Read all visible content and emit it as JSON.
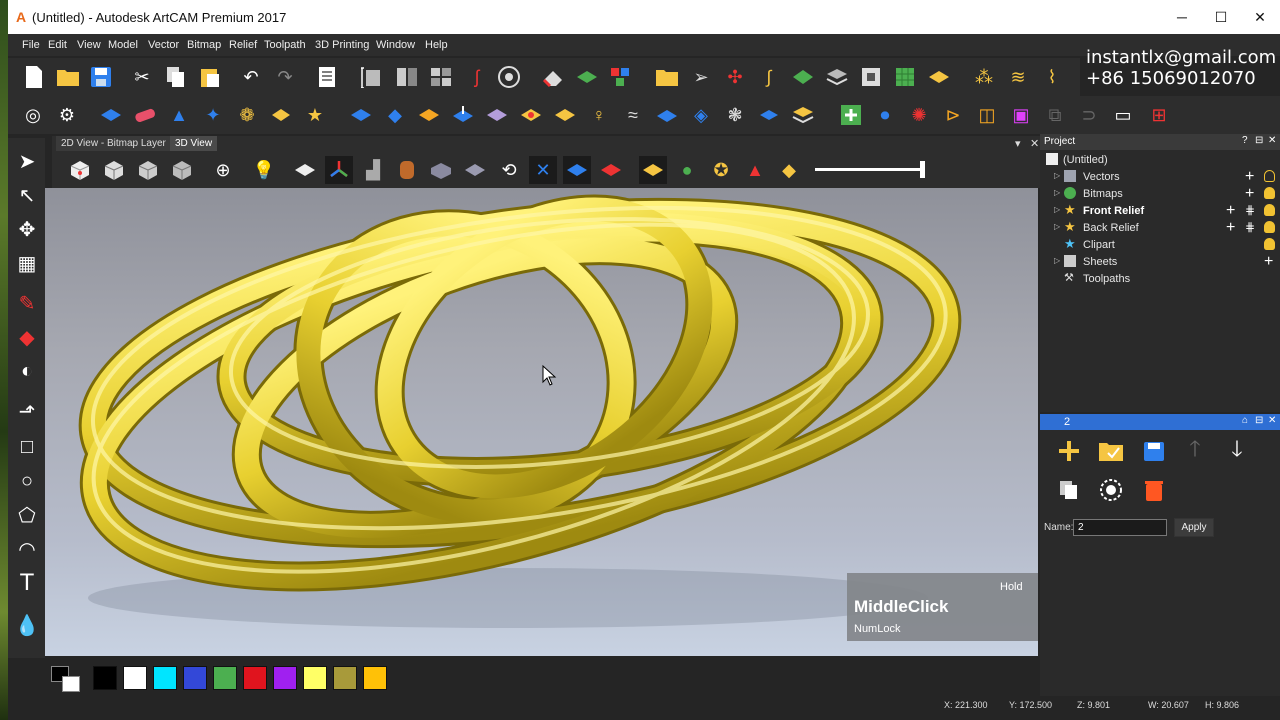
{
  "window": {
    "title": "(Untitled) - Autodesk ArtCAM Premium 2017",
    "app_icon": "A",
    "minimize": "─",
    "maximize": "☐",
    "close": "✕"
  },
  "menu": [
    "File",
    "Edit",
    "View",
    "Model",
    "Vector",
    "Bitmap",
    "Relief",
    "Toolpath",
    "3D Printing",
    "Window",
    "Help"
  ],
  "contact": {
    "email": "instantlx@gmail.com",
    "phone": "+86 15069012070"
  },
  "tabs": {
    "bitmap": "2D View - Bitmap Layer",
    "view3d": "3D View",
    "close": "✕",
    "pin": "▾"
  },
  "overlay": {
    "hold": "Hold",
    "key": "MiddleClick",
    "numlock": "NumLock"
  },
  "project": {
    "header": "Project",
    "header_controls": [
      "?",
      "⊟",
      "✕"
    ],
    "tree": [
      {
        "label": "(Untitled)",
        "bold": false
      },
      {
        "label": "Vectors",
        "bold": false
      },
      {
        "label": "Bitmaps",
        "bold": false
      },
      {
        "label": "Front Relief",
        "bold": true
      },
      {
        "label": "Back Relief",
        "bold": false
      },
      {
        "label": "Clipart",
        "bold": false
      },
      {
        "label": "Sheets",
        "bold": false
      },
      {
        "label": "Toolpaths",
        "bold": false
      }
    ]
  },
  "panel2": {
    "header": "2",
    "header_controls": [
      "⌂",
      "⊟",
      "✕"
    ],
    "name_label": "Name:",
    "name_value": "2",
    "apply": "Apply"
  },
  "palette": {
    "colors": [
      "#000000",
      "#ffffff",
      "#00e5ff",
      "#3348d8",
      "#4caf50",
      "#e0141e",
      "#a020f0",
      "#ffff66",
      "#a89a3a",
      "#ffc107"
    ]
  },
  "status": {
    "x": "X: 221.300",
    "y": "Y: 172.500",
    "z": "Z: 9.801",
    "w": "W: 20.607",
    "h": "H: 9.806"
  },
  "accent": "#2f6fd4",
  "relief_color": "#e8d030"
}
